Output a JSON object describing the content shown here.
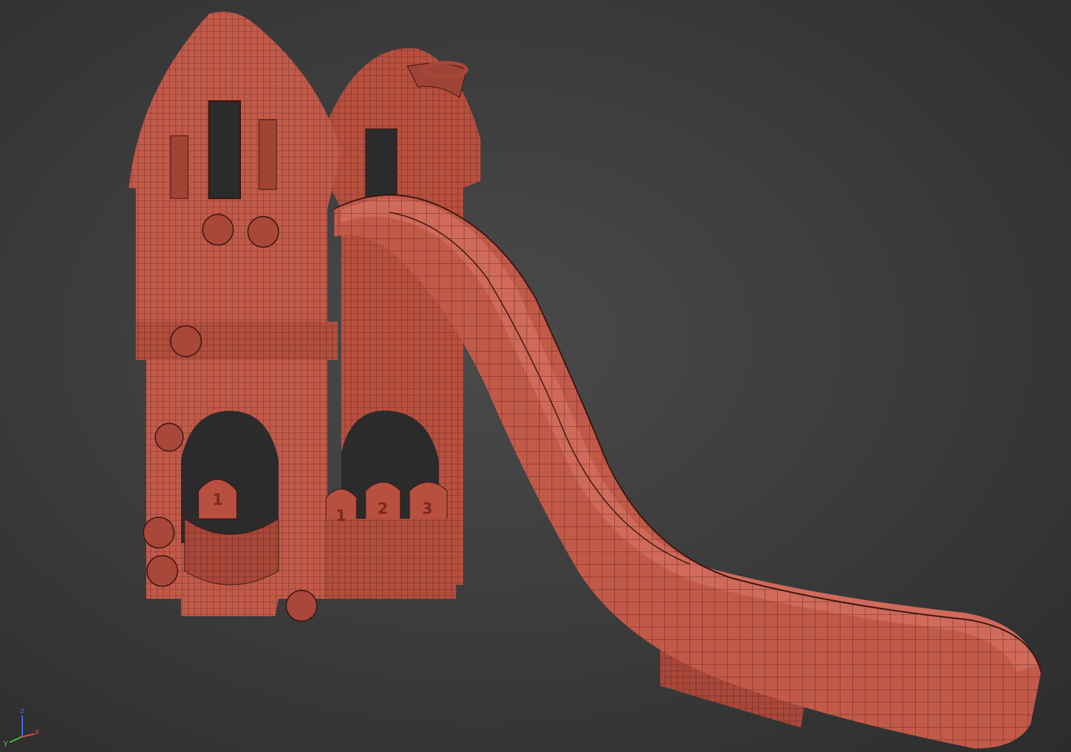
{
  "viewport": {
    "background": "#3c3c3c",
    "model_color": "#c25a4a",
    "model_shade": "#a8473a",
    "model_light": "#d46e5e",
    "wire_color": "#3a1410"
  },
  "model": {
    "panel_numbers": [
      "1",
      "1",
      "2",
      "3"
    ]
  },
  "gizmo": {
    "z_label": "z",
    "y_label": "y",
    "x_label": "x",
    "colors": {
      "x": "#e04a3a",
      "y": "#4ac04a",
      "z": "#4a6ae0"
    }
  }
}
